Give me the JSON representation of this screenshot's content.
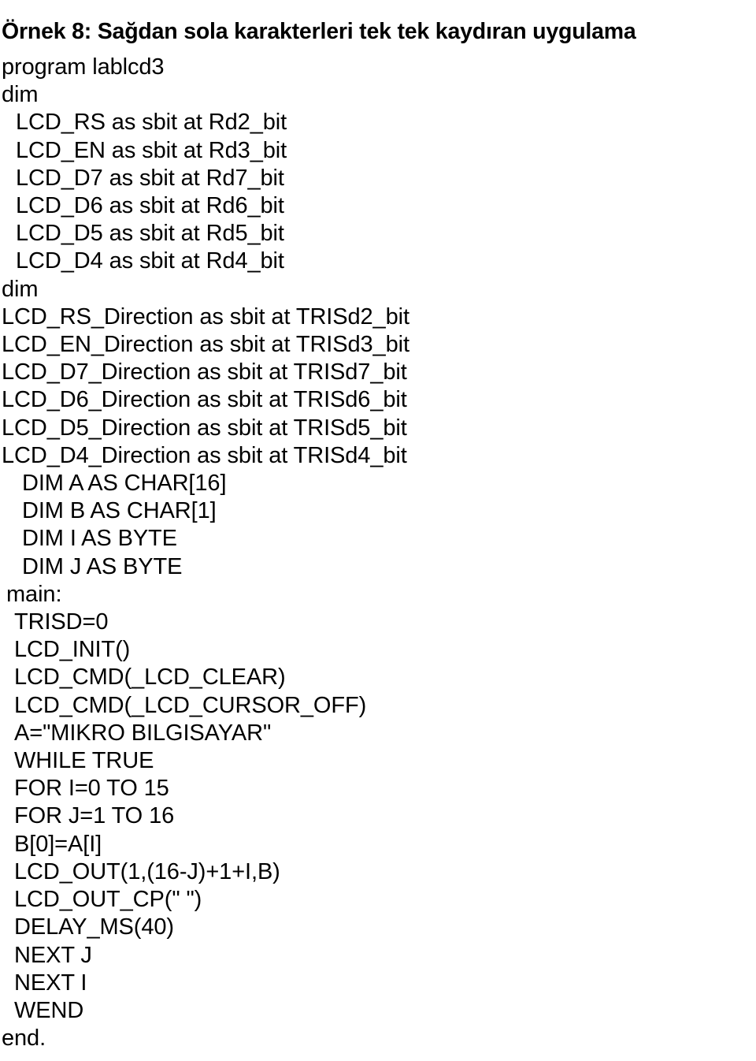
{
  "document": {
    "title": "Örnek 8: Sağdan sola karakterleri tek tek kaydıran uygulama",
    "language": "tr",
    "code_listing": {
      "language_hint": "mikroBasic",
      "lines": [
        {
          "text": "program lablcd3",
          "indent": 0
        },
        {
          "text": "dim",
          "indent": 0
        },
        {
          "text": "LCD_RS as sbit at Rd2_bit",
          "indent": 3
        },
        {
          "text": "LCD_EN as sbit at Rd3_bit",
          "indent": 3
        },
        {
          "text": "LCD_D7 as sbit at Rd7_bit",
          "indent": 3
        },
        {
          "text": "LCD_D6 as sbit at Rd6_bit",
          "indent": 3
        },
        {
          "text": "LCD_D5 as sbit at Rd5_bit",
          "indent": 3
        },
        {
          "text": "LCD_D4 as sbit at Rd4_bit",
          "indent": 3
        },
        {
          "text": "dim",
          "indent": 0
        },
        {
          "text": "LCD_RS_Direction as sbit at TRISd2_bit",
          "indent": 0
        },
        {
          "text": "LCD_EN_Direction as sbit at TRISd3_bit",
          "indent": 0
        },
        {
          "text": "LCD_D7_Direction as sbit at TRISd7_bit",
          "indent": 0
        },
        {
          "text": "LCD_D6_Direction as sbit at TRISd6_bit",
          "indent": 0
        },
        {
          "text": "LCD_D5_Direction as sbit at TRISd5_bit",
          "indent": 0
        },
        {
          "text": "LCD_D4_Direction as sbit at TRISd4_bit",
          "indent": 0
        },
        {
          "text": "DIM A AS CHAR[16]",
          "indent": 4
        },
        {
          "text": "DIM B AS CHAR[1]",
          "indent": 4
        },
        {
          "text": "DIM I AS BYTE",
          "indent": 4
        },
        {
          "text": "DIM J AS BYTE",
          "indent": 4
        },
        {
          "text": "main:",
          "indent": 1
        },
        {
          "text": "TRISD=0",
          "indent": 2
        },
        {
          "text": "LCD_INIT()",
          "indent": 2
        },
        {
          "text": "LCD_CMD(_LCD_CLEAR)",
          "indent": 2
        },
        {
          "text": "LCD_CMD(_LCD_CURSOR_OFF)",
          "indent": 2
        },
        {
          "text": "A=\"MIKRO BILGISAYAR\"",
          "indent": 2
        },
        {
          "text": "WHILE TRUE",
          "indent": 2
        },
        {
          "text": "FOR I=0 TO 15",
          "indent": 2
        },
        {
          "text": "FOR J=1 TO 16",
          "indent": 2
        },
        {
          "text": "B[0]=A[I]",
          "indent": 2
        },
        {
          "text": "LCD_OUT(1,(16-J)+1+I,B)",
          "indent": 2
        },
        {
          "text": "LCD_OUT_CP(\" \")",
          "indent": 2
        },
        {
          "text": "DELAY_MS(40)",
          "indent": 2
        },
        {
          "text": "NEXT J",
          "indent": 2
        },
        {
          "text": "NEXT I",
          "indent": 2
        },
        {
          "text": "WEND",
          "indent": 2
        },
        {
          "text": "end.",
          "indent": 0
        }
      ]
    }
  },
  "colors": {
    "text": "#000000",
    "background": "#ffffff"
  }
}
